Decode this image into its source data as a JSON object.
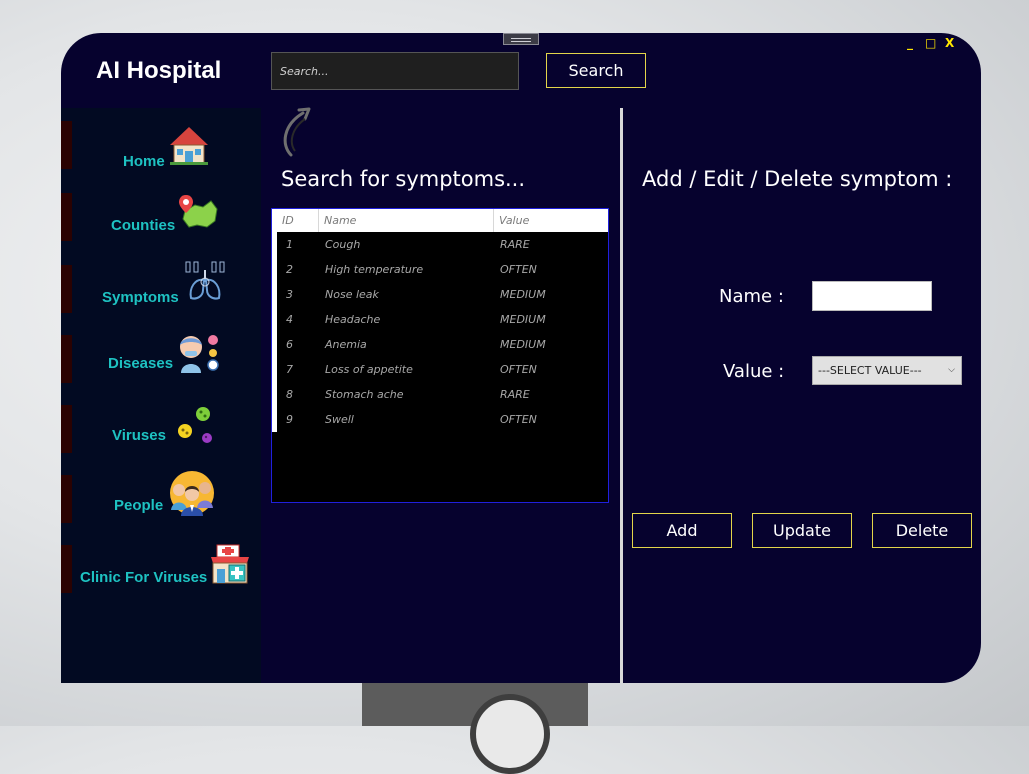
{
  "header": {
    "title": "AI Hospital",
    "search_placeholder": "Search...",
    "search_button": "Search",
    "window_controls": {
      "minimize": "_",
      "maximize": "□",
      "close": "X"
    }
  },
  "sidebar": {
    "items": [
      {
        "label": "Home",
        "icon": "house-icon"
      },
      {
        "label": "Counties",
        "icon": "map-pin-icon"
      },
      {
        "label": "Symptoms",
        "icon": "lungs-icon"
      },
      {
        "label": "Diseases",
        "icon": "sick-person-icon"
      },
      {
        "label": "Viruses",
        "icon": "virus-icon"
      },
      {
        "label": "People",
        "icon": "people-icon"
      },
      {
        "label": "Clinic For Viruses",
        "icon": "clinic-icon"
      }
    ]
  },
  "left_panel": {
    "heading": "Search for symptoms...",
    "table": {
      "columns": [
        "ID",
        "Name",
        "Value"
      ],
      "rows": [
        [
          "1",
          "Cough",
          "RARE"
        ],
        [
          "2",
          "High temperature",
          "OFTEN"
        ],
        [
          "3",
          "Nose leak",
          "MEDIUM"
        ],
        [
          "4",
          "Headache",
          "MEDIUM"
        ],
        [
          "6",
          "Anemia",
          "MEDIUM"
        ],
        [
          "7",
          "Loss of appetite",
          "OFTEN"
        ],
        [
          "8",
          "Stomach ache",
          "RARE"
        ],
        [
          "9",
          "Swell",
          "OFTEN"
        ]
      ]
    }
  },
  "right_panel": {
    "heading": "Add / Edit / Delete symptom :",
    "name_label": "Name :",
    "name_value": "",
    "value_label": "Value :",
    "value_selected": "---SELECT VALUE---",
    "buttons": {
      "add": "Add",
      "update": "Update",
      "delete": "Delete"
    }
  },
  "colors": {
    "window_bg": "#06022e",
    "sidebar_bg": "#020a22",
    "nav_text": "#1ec2c2",
    "button_border": "#e2d54a",
    "window_controls": "#ffe600"
  }
}
